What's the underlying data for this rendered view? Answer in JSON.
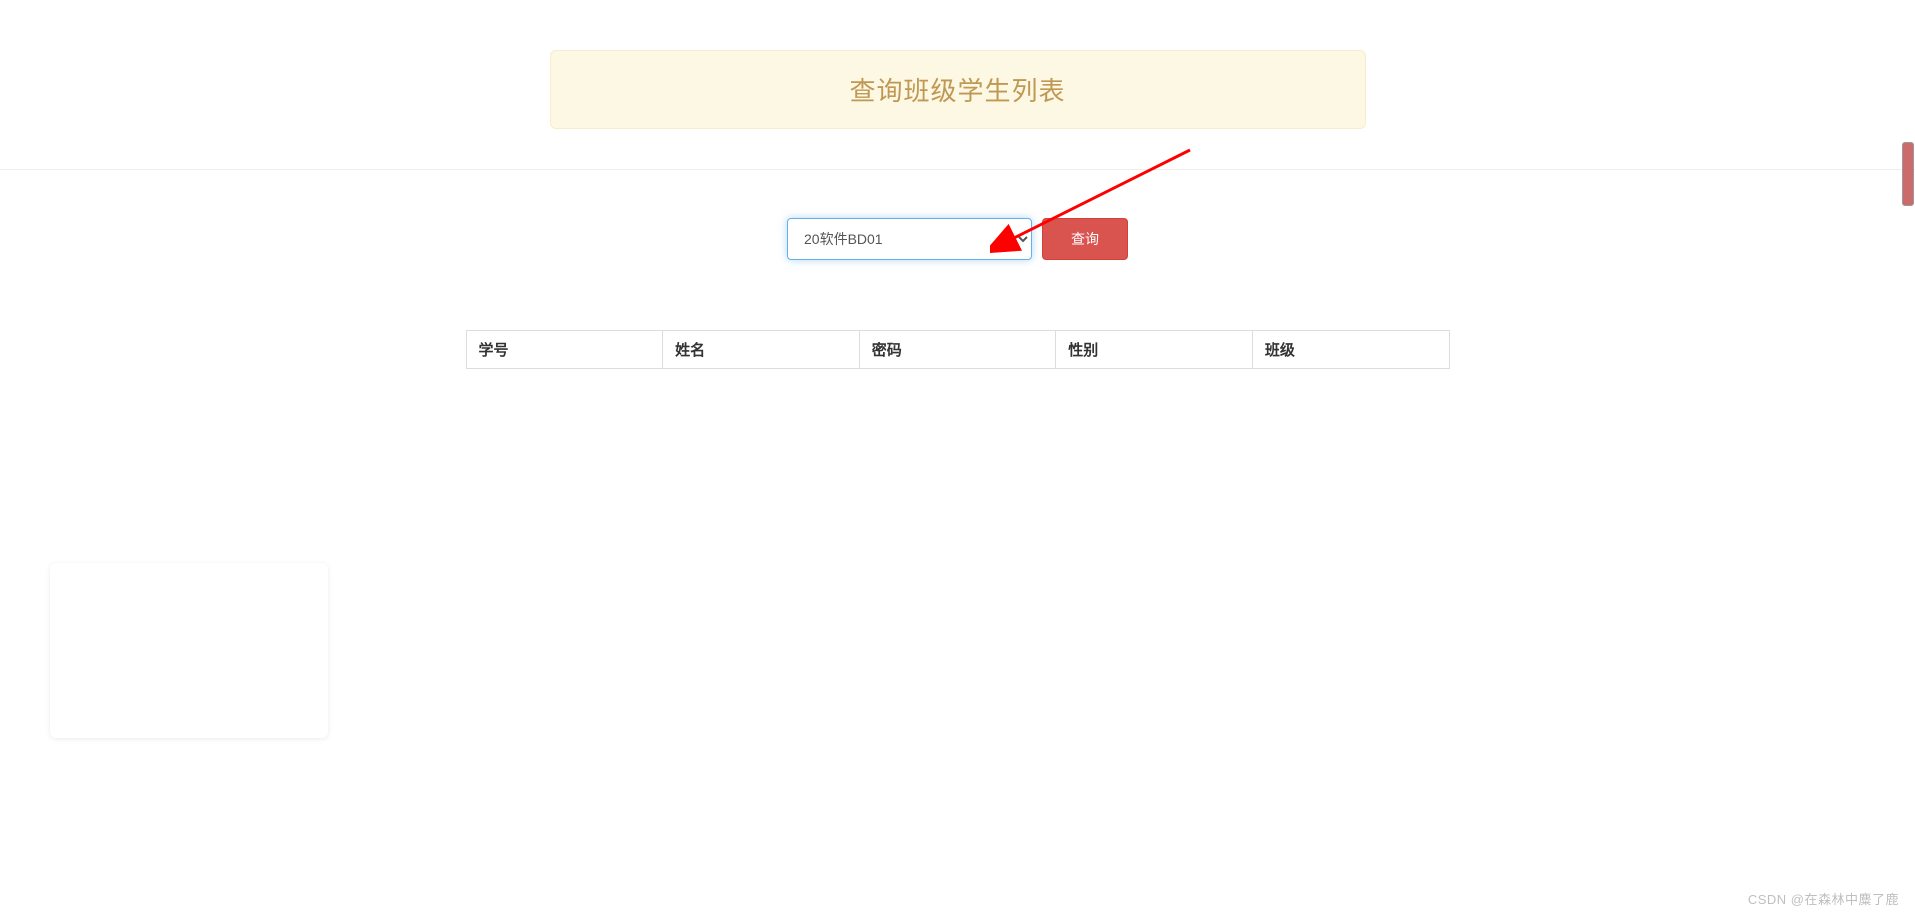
{
  "header": {
    "title": "查询班级学生列表"
  },
  "form": {
    "class_select": {
      "selected": "20软件BD01",
      "options": [
        "20软件BD01"
      ]
    },
    "query_button_label": "查询"
  },
  "table": {
    "columns": [
      "学号",
      "姓名",
      "密码",
      "性别",
      "班级"
    ],
    "rows": []
  },
  "watermark": "CSDN @在森林中麋了鹿"
}
